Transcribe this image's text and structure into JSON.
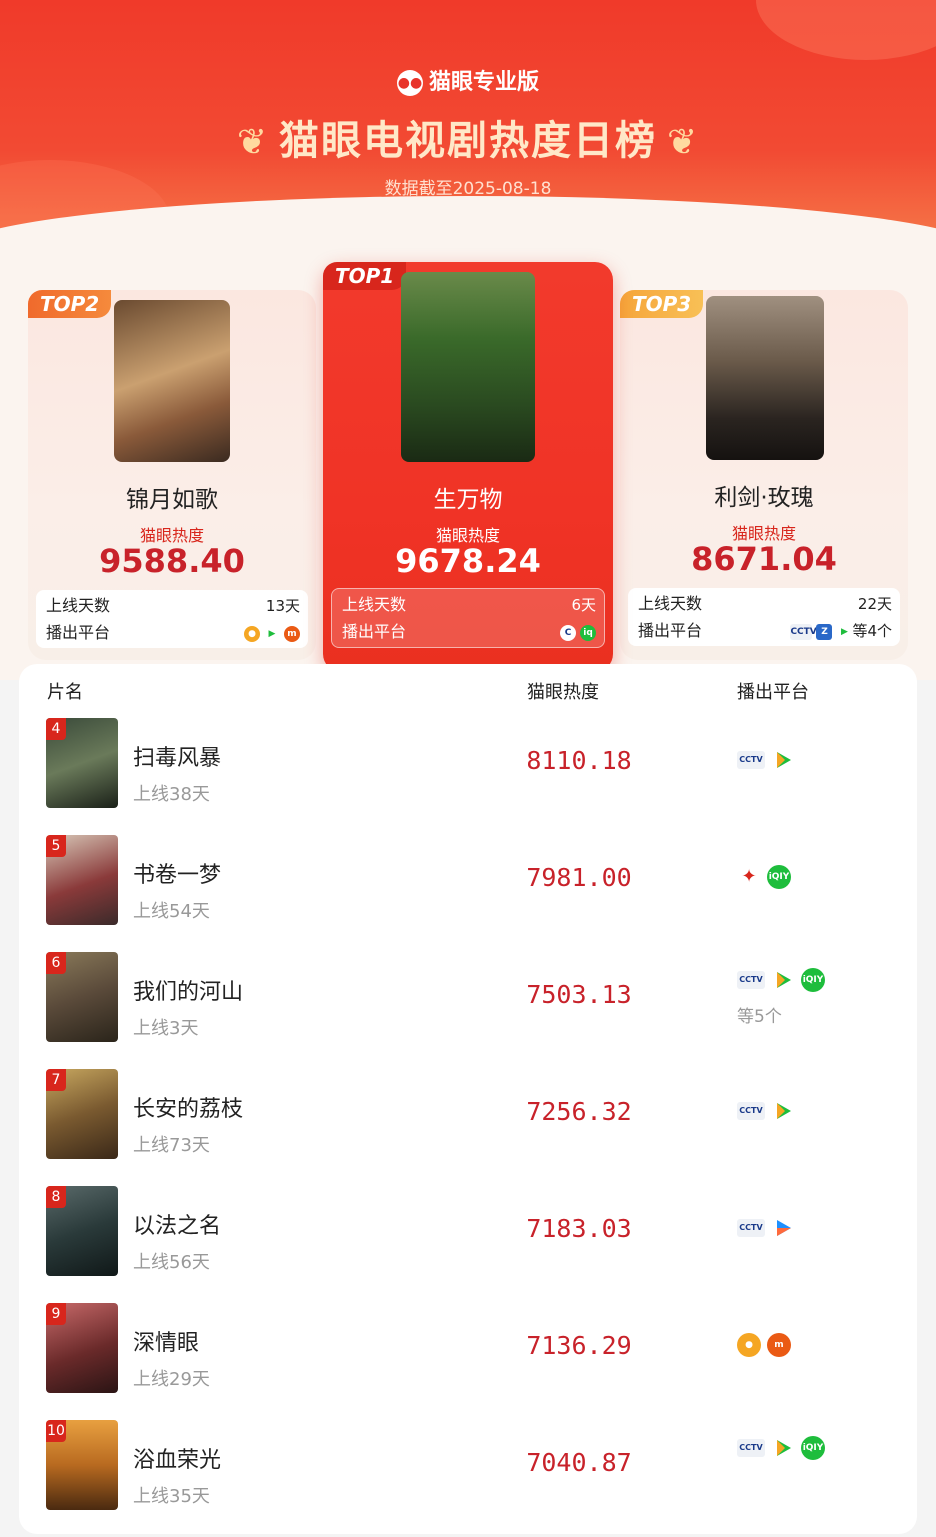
{
  "header": {
    "brand": "猫眼专业版",
    "title": "猫眼电视剧热度日榜",
    "date": "数据截至2025-08-18"
  },
  "podium": [
    {
      "rank_label": "TOP2",
      "title": "锦月如歌",
      "heat_label": "猫眼热度",
      "score": "9588.40",
      "days_label": "上线天数",
      "days": "13天",
      "platform_label": "播出平台",
      "platforms": [
        "mango-icon",
        "tencent-icon",
        "mgtv-icon"
      ],
      "more": ""
    },
    {
      "rank_label": "TOP1",
      "title": "生万物",
      "heat_label": "猫眼热度",
      "score": "9678.24",
      "days_label": "上线天数",
      "days": "6天",
      "platform_label": "播出平台",
      "platforms": [
        "cctv-icon",
        "iqiyi-icon"
      ],
      "more": ""
    },
    {
      "rank_label": "TOP3",
      "title": "利剑·玫瑰",
      "heat_label": "猫眼热度",
      "score": "8671.04",
      "days_label": "上线天数",
      "days": "22天",
      "platform_label": "播出平台",
      "platforms": [
        "cctv-icon",
        "zhejiang-icon",
        "tencent-icon"
      ],
      "more": "等4个"
    }
  ],
  "list_header": {
    "name": "片名",
    "heat": "猫眼热度",
    "platform": "播出平台"
  },
  "rows": [
    {
      "rank": "4",
      "title": "扫毒风暴",
      "days": "上线38天",
      "score": "8110.18",
      "platforms": [
        "cctv-icon",
        "tencent-icon"
      ],
      "more": ""
    },
    {
      "rank": "5",
      "title": "书卷一梦",
      "days": "上线54天",
      "score": "7981.00",
      "platforms": [
        "jiangsu-icon",
        "iqiyi-icon"
      ],
      "more": ""
    },
    {
      "rank": "6",
      "title": "我们的河山",
      "days": "上线3天",
      "score": "7503.13",
      "platforms": [
        "cctv-icon",
        "tencent-icon",
        "iqiyi-icon"
      ],
      "more": "等5个"
    },
    {
      "rank": "7",
      "title": "长安的荔枝",
      "days": "上线73天",
      "score": "7256.32",
      "platforms": [
        "cctv-icon",
        "tencent-icon"
      ],
      "more": ""
    },
    {
      "rank": "8",
      "title": "以法之名",
      "days": "上线56天",
      "score": "7183.03",
      "platforms": [
        "cctv-icon",
        "youku-icon"
      ],
      "more": ""
    },
    {
      "rank": "9",
      "title": "深情眼",
      "days": "上线29天",
      "score": "7136.29",
      "platforms": [
        "mango-icon",
        "mgtv-icon"
      ],
      "more": ""
    },
    {
      "rank": "10",
      "title": "浴血荣光",
      "days": "上线35天",
      "score": "7040.87",
      "platforms": [
        "cctv-icon",
        "tencent-icon",
        "iqiyi-icon"
      ],
      "more": ""
    }
  ]
}
